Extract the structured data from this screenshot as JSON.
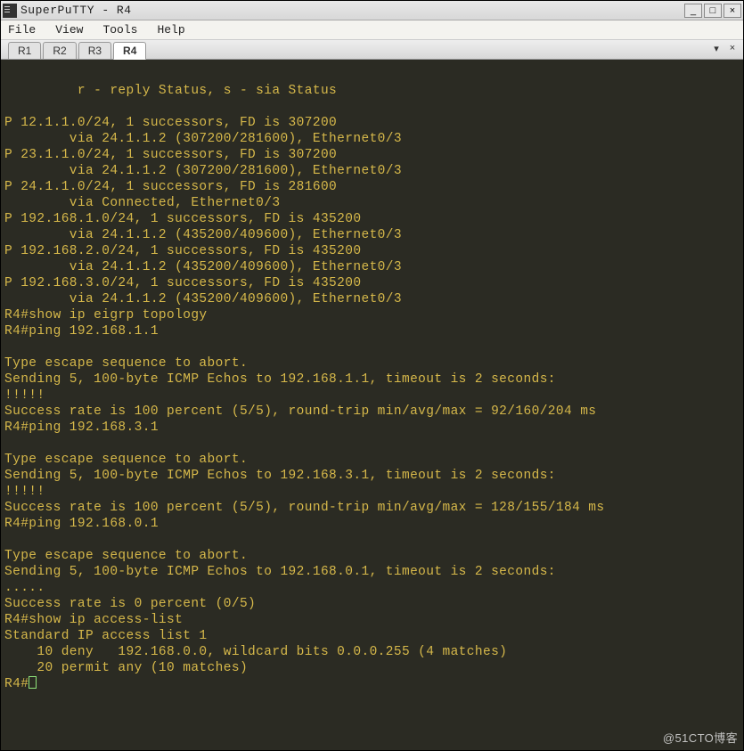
{
  "window": {
    "title": "SuperPuTTY - R4"
  },
  "menu": {
    "file": "File",
    "view": "View",
    "tools": "Tools",
    "help": "Help"
  },
  "tabs": [
    "R1",
    "R2",
    "R3",
    "R4"
  ],
  "active_tab_index": 3,
  "terminal": {
    "lines": [
      "       r - reply Status, s - sia Status",
      "",
      "P 12.1.1.0/24, 1 successors, FD is 307200",
      "        via 24.1.1.2 (307200/281600), Ethernet0/3",
      "P 23.1.1.0/24, 1 successors, FD is 307200",
      "        via 24.1.1.2 (307200/281600), Ethernet0/3",
      "P 24.1.1.0/24, 1 successors, FD is 281600",
      "        via Connected, Ethernet0/3",
      "P 192.168.1.0/24, 1 successors, FD is 435200",
      "        via 24.1.1.2 (435200/409600), Ethernet0/3",
      "P 192.168.2.0/24, 1 successors, FD is 435200",
      "        via 24.1.1.2 (435200/409600), Ethernet0/3",
      "P 192.168.3.0/24, 1 successors, FD is 435200",
      "        via 24.1.1.2 (435200/409600), Ethernet0/3",
      "R4#show ip eigrp topology",
      "R4#ping 192.168.1.1",
      "",
      "Type escape sequence to abort.",
      "Sending 5, 100-byte ICMP Echos to 192.168.1.1, timeout is 2 seconds:",
      "!!!!!",
      "Success rate is 100 percent (5/5), round-trip min/avg/max = 92/160/204 ms",
      "R4#ping 192.168.3.1",
      "",
      "Type escape sequence to abort.",
      "Sending 5, 100-byte ICMP Echos to 192.168.3.1, timeout is 2 seconds:",
      "!!!!!",
      "Success rate is 100 percent (5/5), round-trip min/avg/max = 128/155/184 ms",
      "R4#ping 192.168.0.1",
      "",
      "Type escape sequence to abort.",
      "Sending 5, 100-byte ICMP Echos to 192.168.0.1, timeout is 2 seconds:",
      ".....",
      "Success rate is 0 percent (0/5)",
      "R4#show ip access-list",
      "Standard IP access list 1",
      "    10 deny   192.168.0.0, wildcard bits 0.0.0.255 (4 matches)",
      "    20 permit any (10 matches)"
    ],
    "prompt": "R4#"
  },
  "watermark": "@51CTO博客",
  "winbtn": {
    "min": "_",
    "max": "□",
    "close": "×"
  },
  "tabctrl": {
    "drop": "▾",
    "close": "×"
  }
}
